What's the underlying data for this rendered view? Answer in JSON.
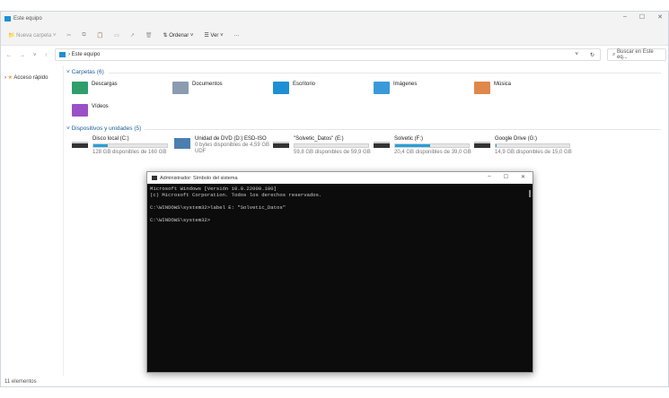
{
  "window": {
    "title": "Este equipo",
    "minimize": "–",
    "maximize": "☐",
    "close": "✕"
  },
  "toolbar": {
    "new_folder": "Nueva carpeta",
    "sort": "Ordenar",
    "view": "Ver",
    "more": "···"
  },
  "address": {
    "path": "Este equipo",
    "search_placeholder": "Buscar en Este eq..."
  },
  "sidebar": {
    "items": [
      {
        "label": "Acceso rápido"
      }
    ]
  },
  "folders": {
    "header": "Carpetas (6)",
    "items": [
      {
        "label": "Descargas",
        "color": "#2e9e6b"
      },
      {
        "label": "Documentos",
        "color": "#8b9bb0"
      },
      {
        "label": "Escritorio",
        "color": "#1e8fd4"
      },
      {
        "label": "Imágenes",
        "color": "#3a9ad9"
      },
      {
        "label": "Música",
        "color": "#e0874a"
      },
      {
        "label": "Vídeos",
        "color": "#9b4fc9"
      }
    ]
  },
  "drives": {
    "header": "Dispositivos y unidades (5)",
    "items": [
      {
        "name": "Disco local (C:)",
        "free": "128 GB disponibles de 160 GB",
        "used_pct": 20
      },
      {
        "name": "Unidad de DVD (D:) ESD-ISO",
        "free": "0 bytes disponibles de 4,59 GB",
        "extra": "UDF"
      },
      {
        "name": "\"Solvetic_Datos\" (E:)",
        "free": "59,8 GB disponibles de 59,9 GB",
        "used_pct": 0
      },
      {
        "name": "Solvetic (F:)",
        "free": "20,4 GB disponibles de 39,0 GB",
        "used_pct": 48
      },
      {
        "name": "Google Drive (G:)",
        "free": "14,9 GB disponibles de 15,0 GB",
        "used_pct": 1
      }
    ]
  },
  "status": "11 elementos",
  "cmd": {
    "title": "Administrador: Símbolo del sistema",
    "lines": [
      "Microsoft Windows [Versión 10.0.22000.100]",
      "(c) Microsoft Corporation. Todos los derechos reservados.",
      "",
      "C:\\WINDOWS\\system32>label E: \"Solvetic_Datos\"",
      "",
      "C:\\WINDOWS\\system32>"
    ]
  }
}
